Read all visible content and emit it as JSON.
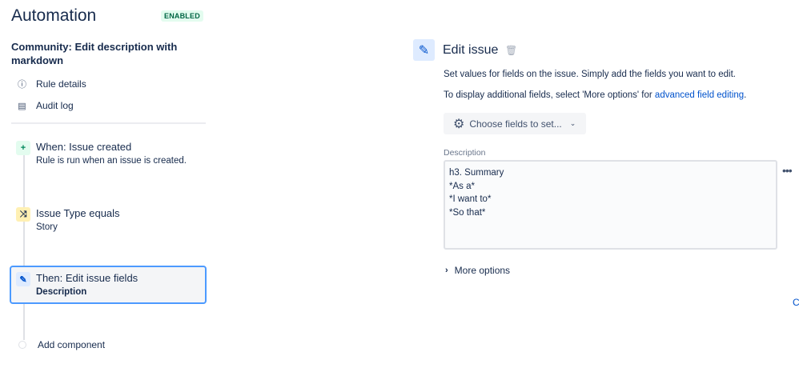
{
  "header": {
    "title": "Automation",
    "status": "ENABLED"
  },
  "rule": {
    "name": "Community: Edit description with markdown"
  },
  "nav": [
    {
      "label": "Rule details",
      "icon": "info-icon"
    },
    {
      "label": "Audit log",
      "icon": "document-icon"
    }
  ],
  "steps": [
    {
      "title": "When: Issue created",
      "subtitle": "Rule is run when an issue is created.",
      "icon": "plus-icon"
    },
    {
      "title": "Issue Type equals",
      "subtitle": "Story",
      "icon": "shuffle-icon"
    },
    {
      "title": "Then: Edit issue fields",
      "subtitle": "Description",
      "icon": "pencil-icon"
    }
  ],
  "add_component": "Add component",
  "panel": {
    "title": "Edit issue",
    "desc1": "Set values for fields on the issue. Simply add the fields you want to edit.",
    "desc2_prefix": "To display additional fields, select 'More options' for ",
    "desc2_link": "advanced field editing",
    "desc2_suffix": ".",
    "choose_label": "Choose fields to set...",
    "field_label": "Description",
    "field_value": "h3. Summary\n*As a*\n*I want to*\n*So that*",
    "more_options": "More options",
    "cut_link": "C"
  },
  "colors": {
    "accent": "#0052cc",
    "selected_border": "#4c9aff",
    "badge_bg": "#e3fcef"
  }
}
